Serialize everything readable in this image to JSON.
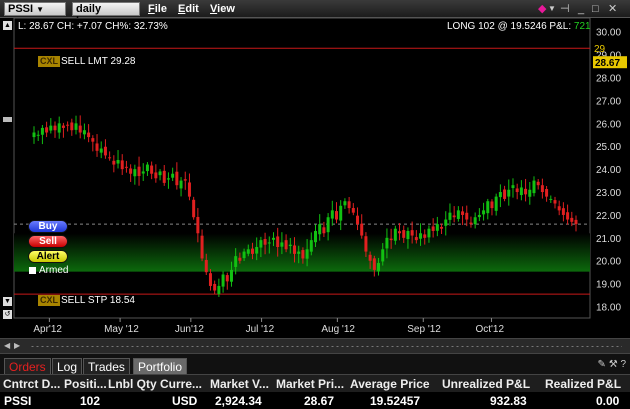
{
  "toolbar": {
    "symbol": "PSSI",
    "bar_type": "daily bars",
    "menus": [
      "File",
      "Edit",
      "View"
    ]
  },
  "chart_header": {
    "stats": "L: 28.67 CH: +7.07 CH%: 32.73%",
    "position_prefix": "LONG 102 @ 19.5246 P&L: ",
    "pnl": "721"
  },
  "orders": {
    "tag": "CXL",
    "sell_limit": "SELL LMT 29.28",
    "sell_stop": "SELL STP 18.54"
  },
  "buttons": {
    "buy": "Buy",
    "sell": "Sell",
    "alert": "Alert",
    "armed": "Armed"
  },
  "colors": {
    "up": "#12c012",
    "down": "#e02020",
    "order_line": "#c81818",
    "band": "#0c6a0c"
  },
  "chart_data": {
    "type": "candlestick",
    "ylim": [
      17.5,
      30.6
    ],
    "y_ticks": [
      "30.00",
      "29.00",
      "28.00",
      "27.00",
      "26.00",
      "25.00",
      "24.00",
      "23.00",
      "22.00",
      "21.00",
      "20.00",
      "19.00",
      "18.00"
    ],
    "x_ticks": [
      "Apr'12",
      "May '12",
      "Jun'12",
      "Jul '12",
      "Aug '12",
      "Sep '12",
      "Oct'12"
    ],
    "x_tick_dates": [
      "2012-04-09",
      "2012-05-07",
      "2012-06-04",
      "2012-07-02",
      "2012-08-01",
      "2012-09-04",
      "2012-10-01"
    ],
    "date_range": [
      "2012-03-26",
      "2012-11-09"
    ],
    "price_labels": [
      "29",
      "28.67"
    ],
    "order_lines": [
      29.28,
      18.54
    ],
    "band": [
      19.5246,
      21.2
    ],
    "reference_line": 21.6,
    "closes": [
      25.6,
      25.5,
      25.8,
      25.6,
      25.9,
      25.7,
      26.0,
      25.8,
      25.9,
      25.7,
      26.0,
      25.6,
      25.7,
      25.4,
      25.2,
      24.8,
      24.9,
      24.6,
      24.5,
      24.2,
      24.4,
      24.0,
      24.1,
      23.8,
      24.0,
      23.7,
      23.9,
      24.2,
      23.8,
      23.6,
      23.9,
      23.4,
      23.6,
      23.8,
      23.3,
      23.5,
      23.5,
      22.8,
      21.9,
      21.2,
      20.1,
      19.5,
      18.9,
      18.7,
      18.9,
      19.4,
      19.1,
      19.6,
      20.2,
      20.0,
      20.4,
      20.5,
      20.3,
      20.6,
      20.9,
      20.7,
      20.8,
      21.0,
      20.6,
      20.8,
      20.5,
      20.7,
      20.3,
      20.4,
      20.1,
      20.5,
      20.9,
      21.3,
      21.6,
      21.2,
      21.9,
      22.2,
      21.8,
      22.4,
      22.6,
      22.3,
      22.1,
      21.6,
      21.1,
      20.4,
      20.0,
      19.6,
      19.9,
      20.5,
      21.0,
      20.9,
      21.4,
      21.2,
      21.0,
      21.3,
      21.1,
      20.9,
      21.2,
      21.0,
      21.4,
      21.3,
      21.6,
      21.4,
      21.8,
      22.1,
      21.9,
      22.2,
      22.0,
      21.8,
      21.6,
      21.9,
      22.0,
      22.2,
      22.6,
      22.3,
      22.8,
      23.0,
      22.7,
      23.1,
      23.3,
      23.0,
      23.2,
      22.9,
      23.1,
      23.5,
      23.3,
      23.0,
      22.8,
      22.7,
      22.5,
      22.2,
      22.0,
      21.8,
      21.7,
      21.6
    ]
  },
  "tabs": [
    "Orders",
    "Log",
    "Trades",
    "Portfolio"
  ],
  "active_tab": "Portfolio",
  "portfolio": {
    "columns": [
      "Cntrct D...",
      "Positi...",
      "Lnbl Qty",
      "Curre...",
      "Market V...",
      "Market Pri...",
      "Average Price",
      "Unrealized P&L",
      "Realized P&L"
    ],
    "rows": [
      [
        "PSSI",
        "102",
        "",
        "USD",
        "2,924.34",
        "28.67",
        "19.52457",
        "932.83",
        "0.00"
      ]
    ]
  }
}
